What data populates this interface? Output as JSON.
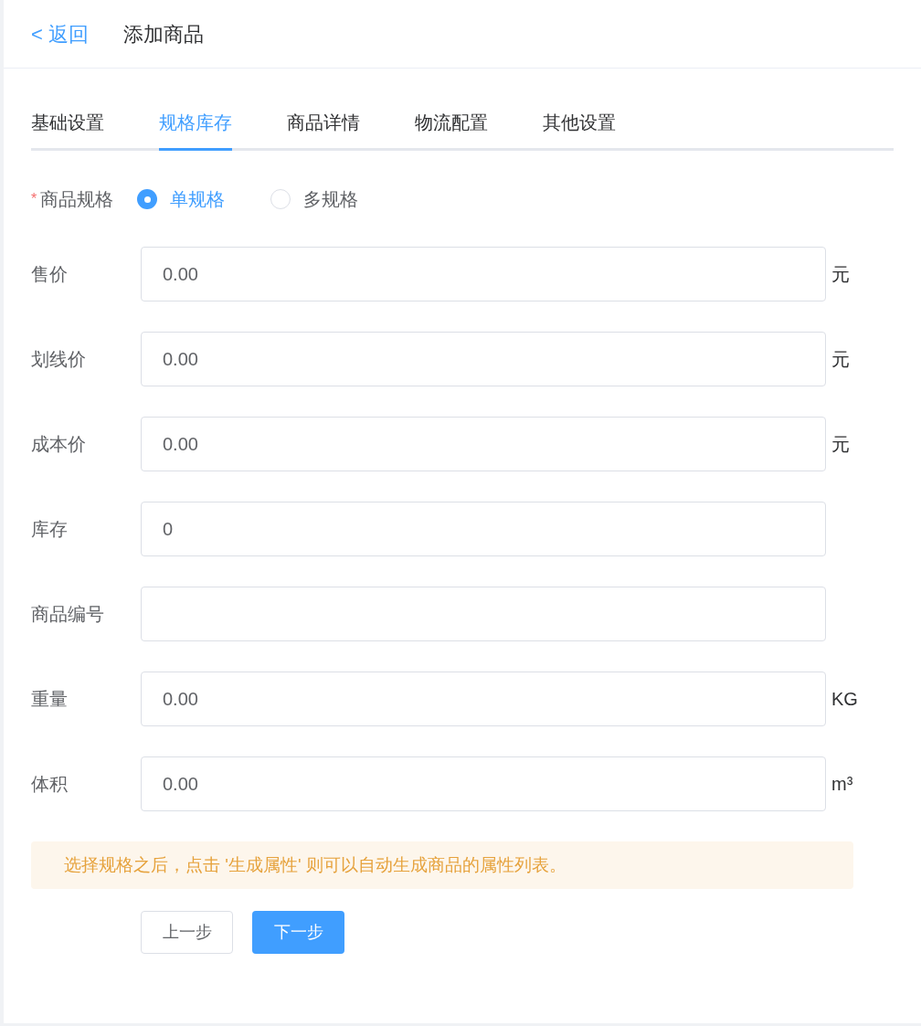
{
  "header": {
    "back": "< 返回",
    "title": "添加商品"
  },
  "tabs": [
    {
      "label": "基础设置",
      "selected": false
    },
    {
      "label": "规格库存",
      "selected": true
    },
    {
      "label": "商品详情",
      "selected": false
    },
    {
      "label": "物流配置",
      "selected": false
    },
    {
      "label": "其他设置",
      "selected": false
    }
  ],
  "spec": {
    "required_mark": "*",
    "label": "商品规格",
    "options": [
      {
        "label": "单规格",
        "selected": true
      },
      {
        "label": "多规格",
        "selected": false
      }
    ]
  },
  "fields": [
    {
      "label": "售价",
      "value": "0.00",
      "suffix": "元"
    },
    {
      "label": "划线价",
      "value": "0.00",
      "suffix": "元"
    },
    {
      "label": "成本价",
      "value": "0.00",
      "suffix": "元"
    },
    {
      "label": "库存",
      "value": "0"
    },
    {
      "label": "商品编号"
    },
    {
      "label": "重量",
      "value": "0.00",
      "suffix": "KG"
    },
    {
      "label": "体积",
      "value": "0.00",
      "suffix": "m³"
    }
  ],
  "notice": "选择规格之后，点击 '生成属性' 则可以自动生成商品的属性列表。",
  "buttons": [
    {
      "label": "上一步",
      "kind": "default"
    },
    {
      "label": "下一步",
      "kind": "primary"
    }
  ]
}
